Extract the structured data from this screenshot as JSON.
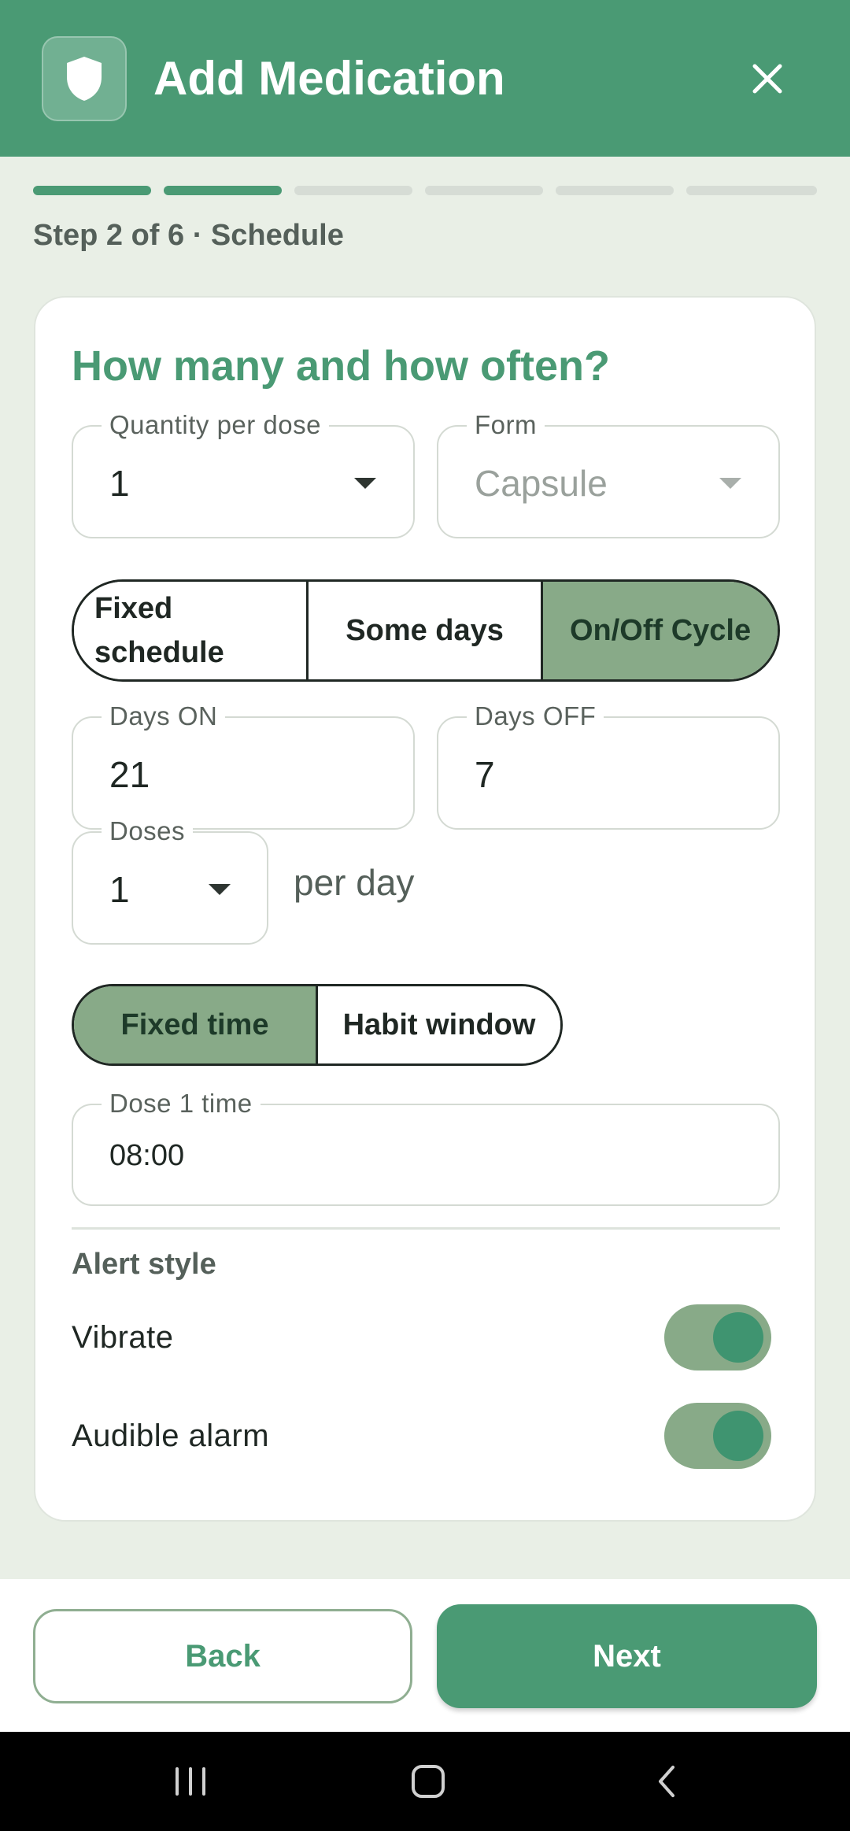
{
  "header": {
    "title": "Add Medication",
    "app_icon": "shield-icon",
    "close_icon": "close-icon"
  },
  "progress": {
    "current_step": 2,
    "total_steps": 6,
    "label": "Step 2 of 6 · Schedule"
  },
  "card": {
    "title": "How many and how often?",
    "quantity": {
      "label": "Quantity per dose",
      "value": "1"
    },
    "form": {
      "label": "Form",
      "value": "Capsule",
      "disabled": true
    },
    "schedule_type": {
      "options": [
        {
          "label": "Fixed\nschedule",
          "active": false
        },
        {
          "label": "Some days",
          "active": false
        },
        {
          "label": "On/Off Cycle",
          "active": true
        }
      ]
    },
    "days_on": {
      "label": "Days ON",
      "value": "21"
    },
    "days_off": {
      "label": "Days OFF",
      "value": "7"
    },
    "doses": {
      "label": "Doses",
      "value": "1",
      "suffix": "per day"
    },
    "time_mode": {
      "options": [
        {
          "label": "Fixed time",
          "active": true
        },
        {
          "label": "Habit window",
          "active": false
        }
      ]
    },
    "dose1_time": {
      "label": "Dose 1 time",
      "value": "08:00"
    },
    "alert_style": {
      "title": "Alert style",
      "vibrate": {
        "label": "Vibrate",
        "on": true
      },
      "audible": {
        "label": "Audible alarm",
        "on": true
      }
    }
  },
  "footer": {
    "back_label": "Back",
    "next_label": "Next"
  },
  "system_nav": {
    "recents_icon": "recents-icon",
    "home_icon": "home-icon",
    "back_icon": "back-icon"
  },
  "colors": {
    "primary": "#4a9a74",
    "accent_soft": "#88aa88",
    "background": "#e9efe6"
  }
}
